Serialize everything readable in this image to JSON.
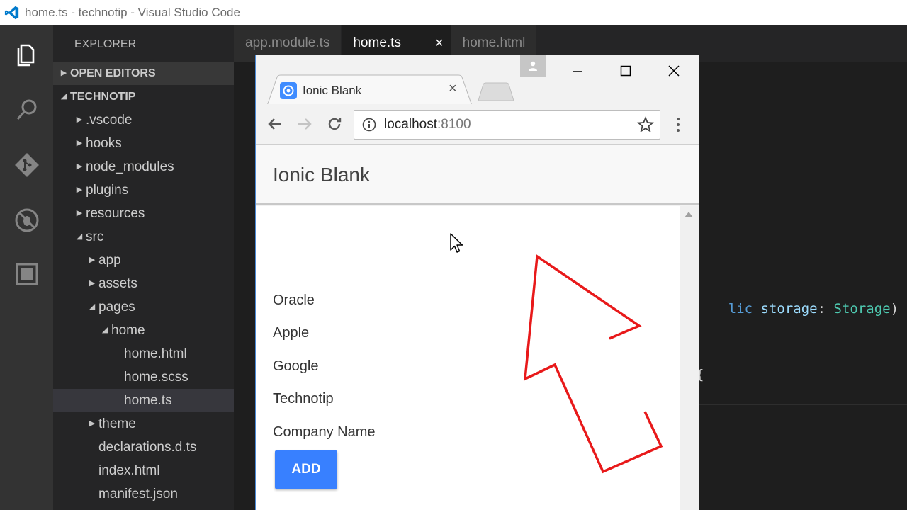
{
  "window": {
    "title": "home.ts - technotip - Visual Studio Code"
  },
  "activity_bar": {
    "icons": [
      "explorer-icon",
      "search-icon",
      "git-icon",
      "debug-icon",
      "extensions-icon"
    ]
  },
  "sidebar": {
    "header": "EXPLORER",
    "sections": {
      "open_editors": "OPEN EDITORS",
      "project": "TECHNOTIP"
    },
    "tree": [
      {
        "label": ".vscode",
        "depth": 0,
        "type": "folder",
        "expanded": false
      },
      {
        "label": "hooks",
        "depth": 0,
        "type": "folder",
        "expanded": false
      },
      {
        "label": "node_modules",
        "depth": 0,
        "type": "folder",
        "expanded": false
      },
      {
        "label": "plugins",
        "depth": 0,
        "type": "folder",
        "expanded": false
      },
      {
        "label": "resources",
        "depth": 0,
        "type": "folder",
        "expanded": false
      },
      {
        "label": "src",
        "depth": 0,
        "type": "folder",
        "expanded": true
      },
      {
        "label": "app",
        "depth": 1,
        "type": "folder",
        "expanded": false
      },
      {
        "label": "assets",
        "depth": 1,
        "type": "folder",
        "expanded": false
      },
      {
        "label": "pages",
        "depth": 1,
        "type": "folder",
        "expanded": true
      },
      {
        "label": "home",
        "depth": 2,
        "type": "folder",
        "expanded": true
      },
      {
        "label": "home.html",
        "depth": 3,
        "type": "file"
      },
      {
        "label": "home.scss",
        "depth": 3,
        "type": "file"
      },
      {
        "label": "home.ts",
        "depth": 3,
        "type": "file",
        "selected": true
      },
      {
        "label": "theme",
        "depth": 1,
        "type": "folder",
        "expanded": false
      },
      {
        "label": "declarations.d.ts",
        "depth": 1,
        "type": "file"
      },
      {
        "label": "index.html",
        "depth": 1,
        "type": "file"
      },
      {
        "label": "manifest.json",
        "depth": 1,
        "type": "file"
      }
    ]
  },
  "editor": {
    "tabs": [
      {
        "label": "app.module.ts",
        "active": false
      },
      {
        "label": "home.ts",
        "active": true,
        "close": "×"
      },
      {
        "label": "home.html",
        "active": false
      }
    ],
    "code": {
      "line1": {
        "kw": "lic",
        "id": "storage",
        "colon": ": ",
        "type": "Storage",
        "rest": ") {"
      },
      "line2": "{"
    }
  },
  "browser": {
    "tab_title": "Ionic Blank",
    "tab_close": "×",
    "url_host": "localhost",
    "url_port": ":8100",
    "app": {
      "title": "Ionic Blank",
      "items": [
        "Oracle",
        "Apple",
        "Google",
        "Technotip",
        "Company Name"
      ],
      "add_button": "ADD"
    }
  },
  "colors": {
    "accent": "#3880ff",
    "annotation_arrow": "#e8191a",
    "vscode_blue": "#007acc"
  }
}
